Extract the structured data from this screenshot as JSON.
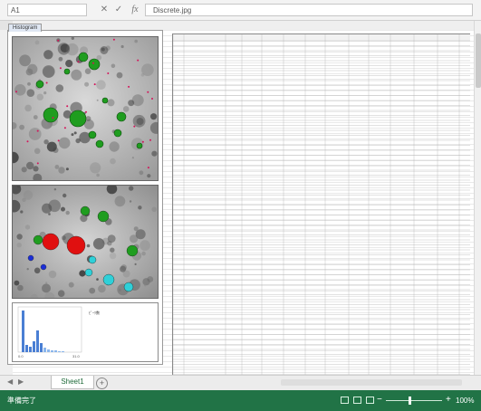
{
  "formula_bar": {
    "name_box": "A1",
    "formula": "Discrete.jpg"
  },
  "embedded_image": {
    "tab_label": "Histogram",
    "stats": {
      "labels": [
        "ﾋﾟｰｸ数",
        "",
        "",
        "",
        ""
      ],
      "values": [
        "",
        "",
        "",
        "",
        ""
      ]
    },
    "stats2": {
      "labels": [
        "",
        "",
        ""
      ],
      "values": [
        "",
        "",
        ""
      ]
    },
    "hist_axis": {
      "left": "0.0",
      "right": "31.0",
      "caption": ""
    }
  },
  "table": {
    "headers": [
      "",
      "",
      "",
      "",
      "",
      "",
      "",
      "",
      "",
      "",
      "",
      "",
      ""
    ],
    "row_count": 68
  },
  "sheet_tab": "Sheet1",
  "status": {
    "text": "準備完了",
    "zoom": "100%"
  },
  "colors": {
    "status_bar": "#217346",
    "particle_green": "#1f9d1f",
    "particle_red": "#e01010",
    "particle_cyan": "#2fd0d8"
  }
}
